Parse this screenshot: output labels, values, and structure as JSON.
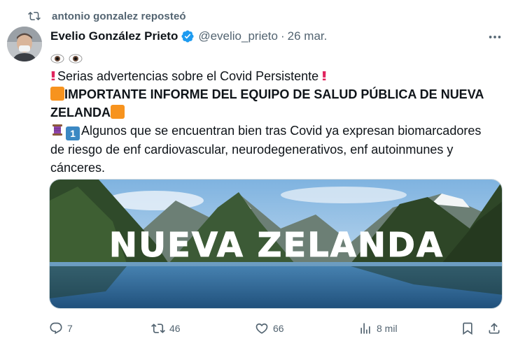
{
  "repost": {
    "label": "antonio gonzalez reposteó"
  },
  "author": {
    "name": "Evelio González Prieto",
    "handle": "@evelio_prieto",
    "separator": "·",
    "date": "26 mar."
  },
  "tweet": {
    "line_eyes": "",
    "line1": "Serias advertencias sobre el Covid Persistente",
    "line2": "IMPORTANTE INFORME DEL EQUIPO DE SALUD PÚBLICA DE NUEVA",
    "line3": "ZELANDA",
    "line4": "Algunos que se encuentran bien tras Covid ya expresan biomarcadores",
    "line5": "de riesgo de enf cardiovascular, neurodegenerativos, enf autoinmunes y",
    "line6": "cánceres."
  },
  "media": {
    "overlay_text": "NUEVA ZELANDA"
  },
  "actions": {
    "replies": "7",
    "reposts": "46",
    "likes": "66",
    "views": "8 mil"
  },
  "colors": {
    "accent": "#1d9bf0",
    "muted": "#536471",
    "text": "#0f1419",
    "emoji_orange": "#f7931e"
  },
  "icons": [
    "repost-icon",
    "verified-icon",
    "more-icon",
    "reply-icon",
    "like-icon",
    "views-icon",
    "bookmark-icon",
    "share-icon"
  ]
}
